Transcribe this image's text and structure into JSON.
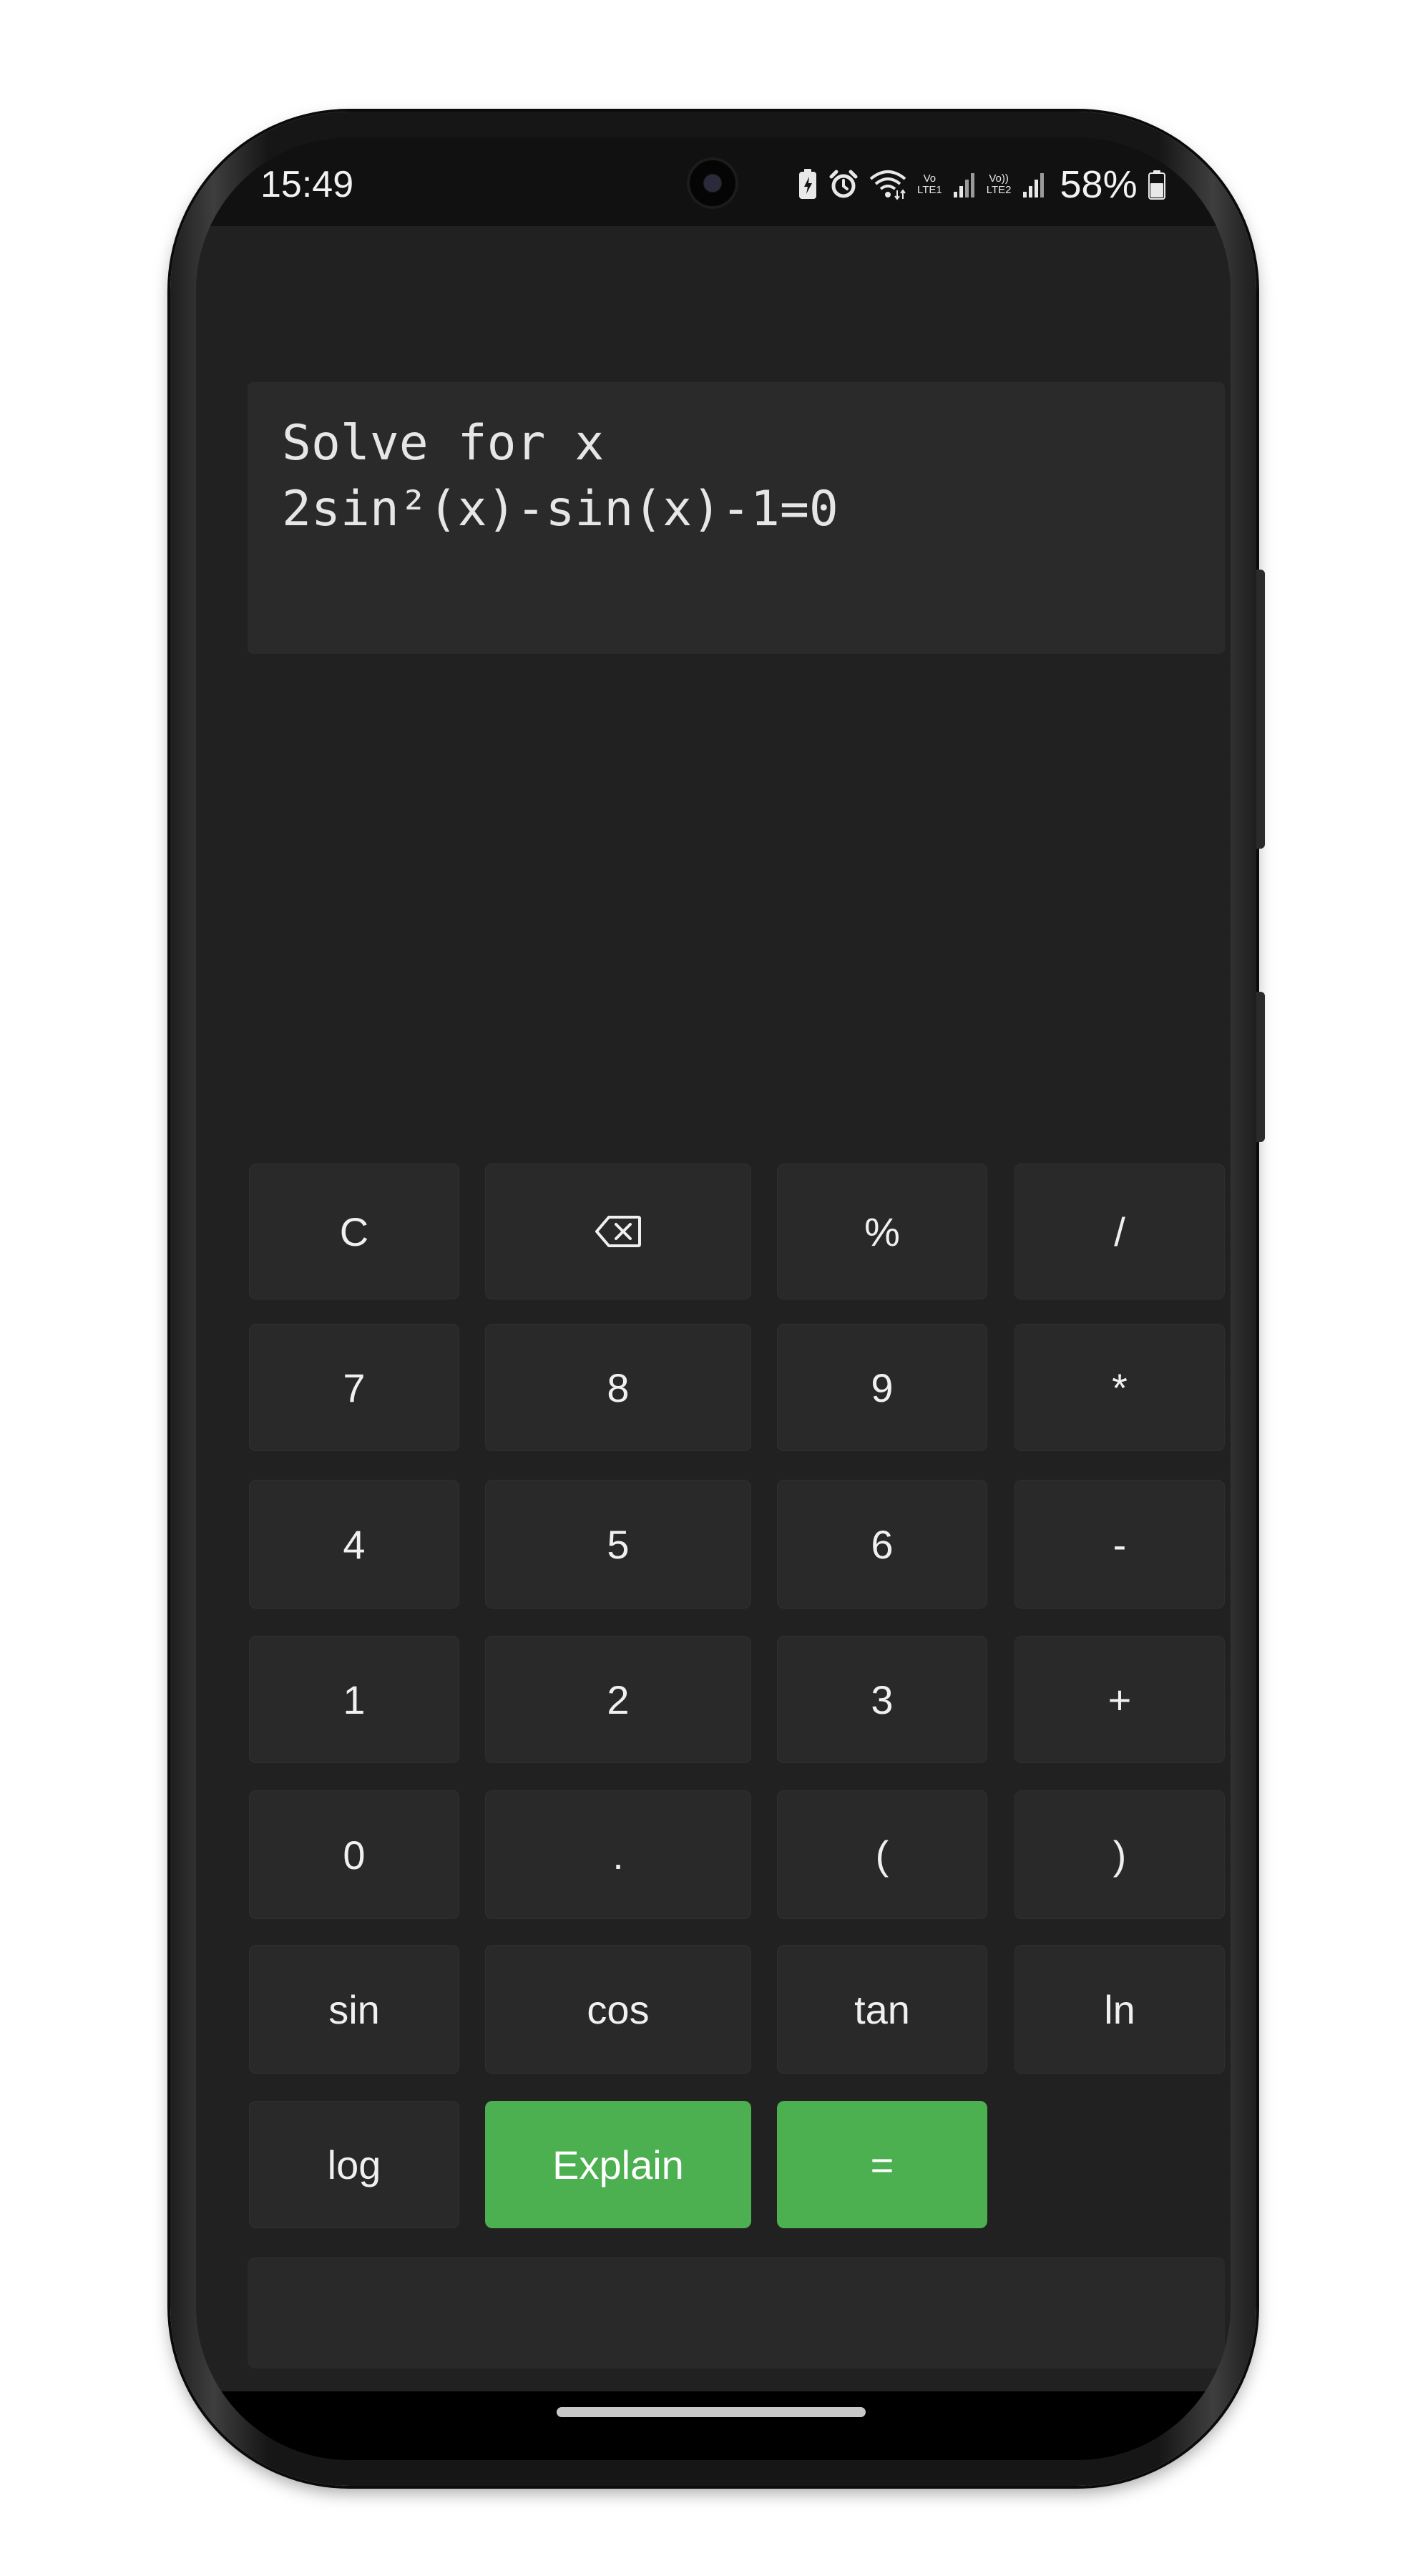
{
  "status_bar": {
    "time": "15:49",
    "volte1_top": "Vo",
    "volte1_bottom": "LTE1",
    "volte2_top": "Vo))",
    "volte2_bottom": "LTE2",
    "battery": "58%"
  },
  "display": {
    "line1": "Solve for x",
    "line2": "2sin²(x)-sin(x)-1=0"
  },
  "keys": {
    "clear": "C",
    "backspace": "⌫",
    "percent": "%",
    "divide": "/",
    "seven": "7",
    "eight": "8",
    "nine": "9",
    "multiply": "*",
    "four": "4",
    "five": "5",
    "six": "6",
    "minus": "-",
    "one": "1",
    "two": "2",
    "three": "3",
    "plus": "+",
    "zero": "0",
    "dot": ".",
    "lparen": "(",
    "rparen": ")",
    "sin": "sin",
    "cos": "cos",
    "tan": "tan",
    "ln": "ln",
    "log": "log",
    "explain": "Explain",
    "equals": "="
  },
  "colors": {
    "accent": "#4caf50",
    "background": "#212121",
    "key": "#292929"
  },
  "icons": {
    "camera": "front-camera-icon",
    "battery_saver": "battery-saver-icon",
    "alarm": "alarm-icon",
    "wifi": "wifi-icon",
    "signal1": "signal-bars-icon",
    "signal2": "signal-bars-icon",
    "battery": "battery-icon"
  }
}
